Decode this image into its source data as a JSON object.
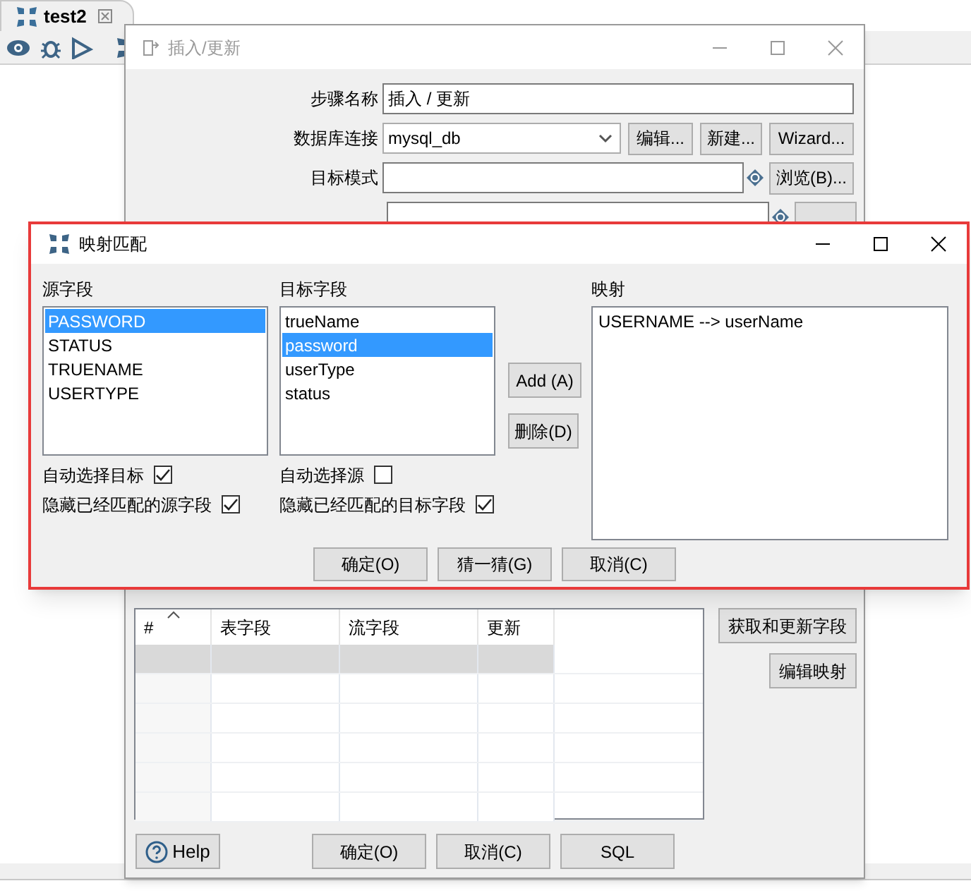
{
  "editor_tab": {
    "title": "test2"
  },
  "main_dialog": {
    "title": "插入/更新",
    "step_name": {
      "label": "步骤名称",
      "value": "插入 / 更新"
    },
    "connection": {
      "label": "数据库连接",
      "value": "mysql_db",
      "buttons": [
        "编辑...",
        "新建...",
        "Wizard..."
      ]
    },
    "target_schema": {
      "label": "目标模式",
      "button": "浏览(B)..."
    },
    "update_fields": {
      "columns": [
        "#",
        "表字段",
        "流字段",
        "更新"
      ],
      "rows": [
        {
          "selected": true
        },
        {
          "selected": false
        },
        {
          "selected": false
        },
        {
          "selected": false
        },
        {
          "selected": false
        },
        {
          "selected": false
        }
      ]
    },
    "side_buttons": [
      "获取和更新字段",
      "编辑映射"
    ],
    "help": "Help",
    "buttons": [
      "确定(O)",
      "取消(C)",
      "SQL"
    ]
  },
  "mapping_dialog": {
    "title": "映射匹配",
    "source": {
      "label": "源字段",
      "items": [
        {
          "text": "PASSWORD",
          "selected": true
        },
        {
          "text": "STATUS",
          "selected": false
        },
        {
          "text": "TRUENAME",
          "selected": false
        },
        {
          "text": "USERTYPE",
          "selected": false
        }
      ]
    },
    "target": {
      "label": "目标字段",
      "items": [
        {
          "text": "trueName",
          "selected": false
        },
        {
          "text": "password",
          "selected": true
        },
        {
          "text": "userType",
          "selected": false
        },
        {
          "text": "status",
          "selected": false
        }
      ]
    },
    "add_button": "Add (A)",
    "delete_button": "删除(D)",
    "mapping": {
      "label": "映射",
      "items": [
        "USERNAME --> userName"
      ]
    },
    "source_options": [
      {
        "label": "自动选择目标",
        "checked": true
      },
      {
        "label": "隐藏已经匹配的源字段",
        "checked": true
      }
    ],
    "target_options": [
      {
        "label": "自动选择源",
        "checked": false
      },
      {
        "label": "隐藏已经匹配的目标字段",
        "checked": true
      }
    ],
    "buttons": [
      "确定(O)",
      "猜一猜(G)",
      "取消(C)"
    ]
  }
}
